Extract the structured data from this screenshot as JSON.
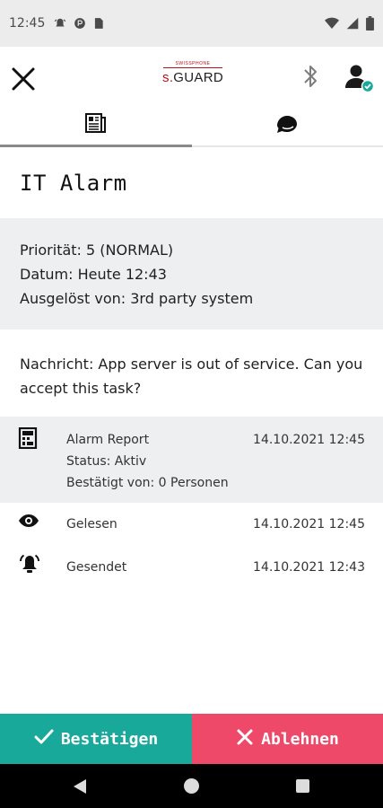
{
  "status_bar": {
    "time": "12:45",
    "icons": [
      "alarm-bell-icon",
      "pocket-icon",
      "sim-icon",
      "wifi-icon",
      "signal-icon",
      "battery-icon"
    ]
  },
  "app_bar": {
    "logo_brand": "SWISSPHONE",
    "logo_name_prefix": "s.",
    "logo_name": "GUARD",
    "icons": [
      "close-icon",
      "bluetooth-icon",
      "user-verified-icon"
    ]
  },
  "tabs": [
    {
      "icon": "document-icon",
      "active": true
    },
    {
      "icon": "chat-icon",
      "active": false
    }
  ],
  "alarm": {
    "title": "IT Alarm",
    "priority": "Priorität: 5 (NORMAL)",
    "date": "Datum: Heute 12:43",
    "triggered_by": "Ausgelöst von: 3rd party system",
    "message": "Nachricht: App server is out of service. Can you accept this task?"
  },
  "history": [
    {
      "icon": "report-icon",
      "lines": [
        "Alarm Report",
        "Status: Aktiv",
        "Bestätigt von: 0 Personen"
      ],
      "date": "14.10.2021 12:45"
    },
    {
      "icon": "eye-icon",
      "label": "Gelesen",
      "date": "14.10.2021 12:45"
    },
    {
      "icon": "alarm-bell-icon",
      "label": "Gesendet",
      "date": "14.10.2021 12:43"
    }
  ],
  "actions": {
    "accept_label": "Bestätigen",
    "reject_label": "Ablehnen",
    "accept_color": "#19a99a",
    "reject_color": "#ee4968"
  }
}
